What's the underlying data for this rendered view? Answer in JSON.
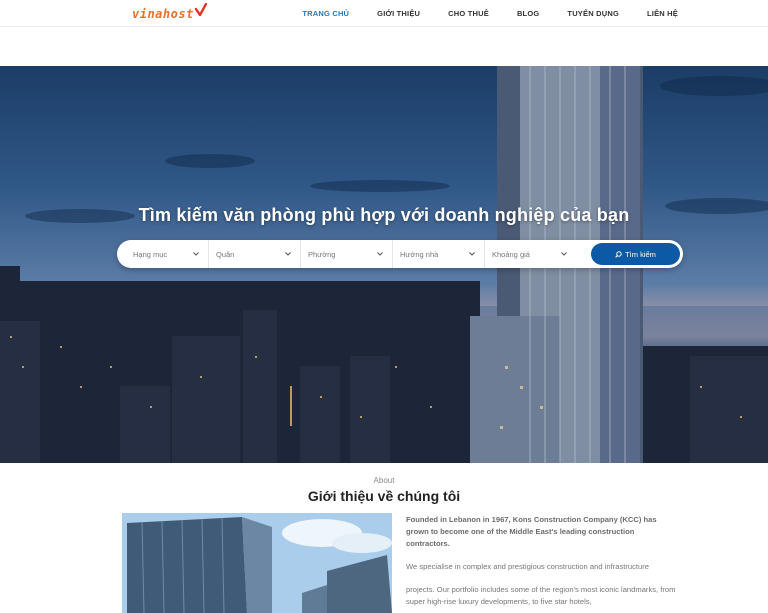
{
  "header": {
    "logo_text": "vinahost",
    "nav": [
      {
        "label": "TRANG CHỦ",
        "active": true
      },
      {
        "label": "GIỚI THIỆU",
        "active": false
      },
      {
        "label": "CHO THUÊ",
        "active": false
      },
      {
        "label": "BLOG",
        "active": false
      },
      {
        "label": "TUYỂN DỤNG",
        "active": false
      },
      {
        "label": "LIÊN HỆ",
        "active": false
      }
    ]
  },
  "hero": {
    "title": "Tìm kiếm văn phòng phù hợp với doanh nghiệp của bạn",
    "search": {
      "fields": [
        "Hạng mục",
        "Quận",
        "Phường",
        "Hướng nhà",
        "Khoảng giá"
      ],
      "button_label": "Tìm kiếm"
    }
  },
  "about": {
    "eyebrow": "About",
    "title": "Giới thiệu về chúng tôi",
    "lead": "Founded in Lebanon in 1967, Kons Construction Company (KCC) has grown to become one of the Middle East's leading construction contractors.",
    "paragraph1": "We specialise in complex and prestigious construction and infrastructure",
    "paragraph2": "projects. Our portfolio includes some of the region's most iconic landmarks, from super high-rise luxury developments, to five star hotels,"
  },
  "colors": {
    "accent": "#1f77c3",
    "button": "#0c5aa6",
    "logo": "#e8702a"
  }
}
